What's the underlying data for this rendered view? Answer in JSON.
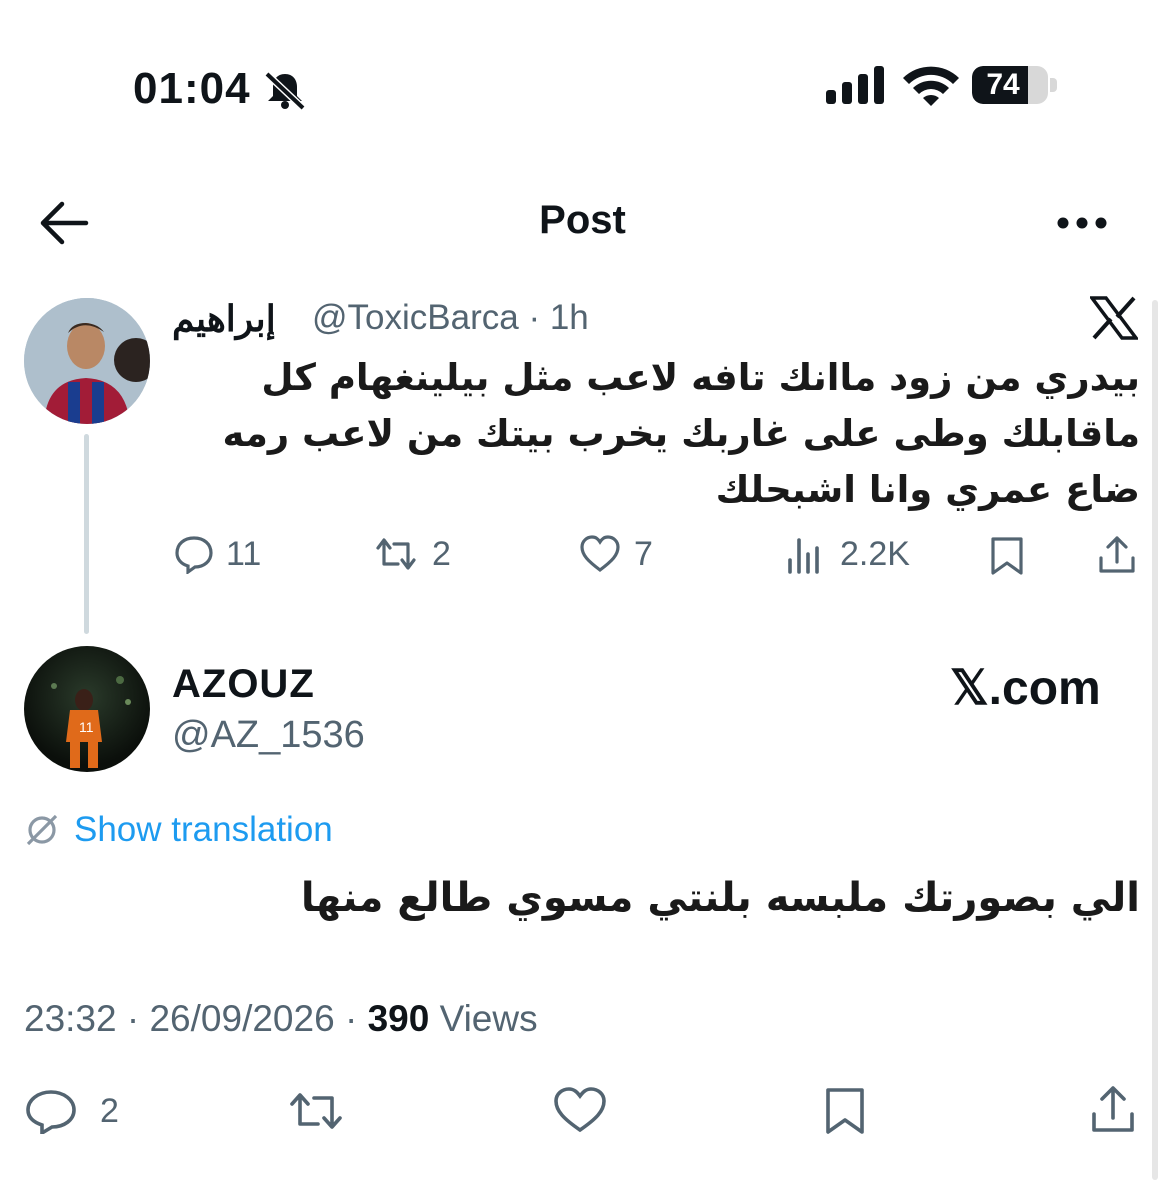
{
  "status_bar": {
    "time": "01:04",
    "battery": "74",
    "battery_level": 0.74
  },
  "header": {
    "title": "Post"
  },
  "parent_post": {
    "display_name": "إبراهيم",
    "handle": "@ToxicBarca",
    "age": "· 1h",
    "text": "بيدري من زود ماانك تافه لاعب مثل بيلينغهام كل ماقابلك وطى على غاربك يخرب بيتك من لاعب رمه ضاع عمري وانا اشبحلك",
    "replies": "11",
    "reposts": "2",
    "likes": "7",
    "views": "2.2K"
  },
  "main_post": {
    "display_name": "AZOUZ",
    "handle": "@AZ_1536",
    "watermark": "𝕏.com",
    "show_translation": "Show translation",
    "text": "الي بصورتك ملبسه بلنتي مسوي طالع منها",
    "time": "23:32",
    "date": "26/09/2026",
    "views_count": "390",
    "views_label": "Views",
    "replies": "2"
  }
}
